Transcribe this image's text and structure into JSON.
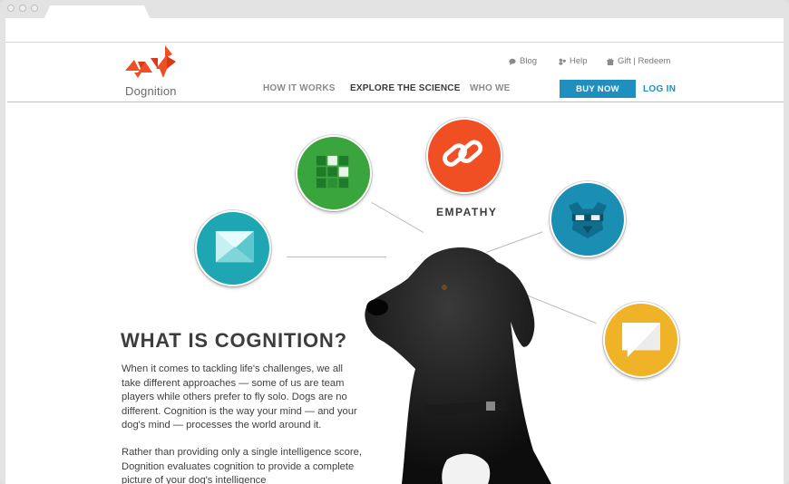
{
  "brand": {
    "name": "Dognition"
  },
  "utility_nav": {
    "blog": "Blog",
    "help": "Help",
    "gift_redeem": "Gift | Redeem"
  },
  "main_nav": {
    "how_it_works": "HOW IT WORKS",
    "explore_the_science": "EXPLORE THE SCIENCE",
    "who_we": "WHO WE"
  },
  "cta": {
    "buy_now": "BUY NOW",
    "log_in": "LOG IN"
  },
  "diagram": {
    "empathy_label": "EMPATHY"
  },
  "content": {
    "heading": "WHAT IS COGNITION?",
    "paragraph_1": "When it comes to tackling life's challenges, we all take different approaches — some of us are team players while others prefer to fly solo. Dogs are no different. Cognition is the way your mind — and your dog's mind — processes the world around it.",
    "paragraph_2": "Rather than providing only a single intelligence score, Dognition evaluates cognition to provide a complete picture of your dog's intelligence"
  },
  "colors": {
    "accent_blue": "#1f8fc0",
    "green": "#3aa53c",
    "orange": "#f04e23",
    "teal": "#1ea7b3",
    "navy_blue": "#1a8fb3",
    "gold": "#f0b226",
    "logo_red": "#f04e23"
  },
  "icons": [
    "envelope-icon",
    "grid-icon",
    "link-chain-icon",
    "dog-mask-icon",
    "speech-bubble-icon",
    "chat-icon",
    "help-icon",
    "gift-icon"
  ]
}
